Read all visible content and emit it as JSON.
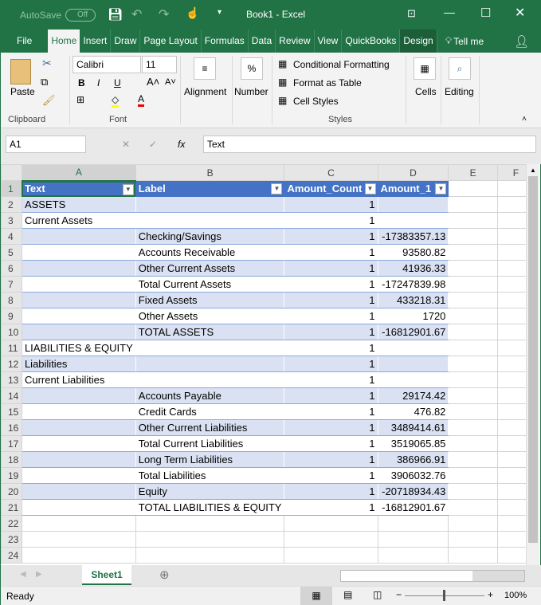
{
  "titlebar": {
    "autosave": "AutoSave",
    "autosave_state": "Off",
    "title": "Book1  -  Excel"
  },
  "tabs": [
    "File",
    "Home",
    "Insert",
    "Draw",
    "Page Layout",
    "Formulas",
    "Data",
    "Review",
    "View",
    "QuickBooks",
    "Design"
  ],
  "tell_me": "Tell me",
  "ribbon": {
    "paste": "Paste",
    "clipboard": "Clipboard",
    "font_name": "Calibri",
    "font_size": "11",
    "bold": "B",
    "italic": "I",
    "underline": "U",
    "font": "Font",
    "alignment": "Alignment",
    "number": "Number",
    "percent": "%",
    "conditional": "Conditional Formatting",
    "format_table": "Format as Table",
    "cell_styles": "Cell Styles",
    "styles": "Styles",
    "cells": "Cells",
    "editing": "Editing"
  },
  "formula_bar": {
    "name_box": "A1",
    "fx": "fx",
    "content": "Text"
  },
  "columns": [
    "A",
    "B",
    "C",
    "D",
    "E",
    "F"
  ],
  "headers": [
    "Text",
    "Label",
    "Amount_Count",
    "Amount_1"
  ],
  "rows": [
    [
      "ASSETS",
      "",
      "1",
      ""
    ],
    [
      "Current Assets",
      "",
      "1",
      ""
    ],
    [
      "",
      "Checking/Savings",
      "1",
      "-17383357.13"
    ],
    [
      "",
      "Accounts Receivable",
      "1",
      "93580.82"
    ],
    [
      "",
      "Other Current Assets",
      "1",
      "41936.33"
    ],
    [
      "",
      "Total Current Assets",
      "1",
      "-17247839.98"
    ],
    [
      "",
      "Fixed Assets",
      "1",
      "433218.31"
    ],
    [
      "",
      "Other Assets",
      "1",
      "1720"
    ],
    [
      "",
      "TOTAL ASSETS",
      "1",
      "-16812901.67"
    ],
    [
      "LIABILITIES & EQUITY",
      "",
      "1",
      ""
    ],
    [
      "Liabilities",
      "",
      "1",
      ""
    ],
    [
      "Current Liabilities",
      "",
      "1",
      ""
    ],
    [
      "",
      "Accounts Payable",
      "1",
      "29174.42"
    ],
    [
      "",
      "Credit Cards",
      "1",
      "476.82"
    ],
    [
      "",
      "Other Current Liabilities",
      "1",
      "3489414.61"
    ],
    [
      "",
      "Total Current Liabilities",
      "1",
      "3519065.85"
    ],
    [
      "",
      "Long Term Liabilities",
      "1",
      "386966.91"
    ],
    [
      "",
      "Total Liabilities",
      "1",
      "3906032.76"
    ],
    [
      "",
      "Equity",
      "1",
      "-20718934.43"
    ],
    [
      "",
      "TOTAL LIABILITIES & EQUITY",
      "1",
      "-16812901.67"
    ]
  ],
  "empty_rows": [
    22,
    23,
    24
  ],
  "sheet_tab": "Sheet1",
  "status": {
    "ready": "Ready",
    "zoom": "100%"
  },
  "colors": {
    "brand": "#217346",
    "table_header": "#4472c4",
    "band": "#d9e1f2"
  }
}
